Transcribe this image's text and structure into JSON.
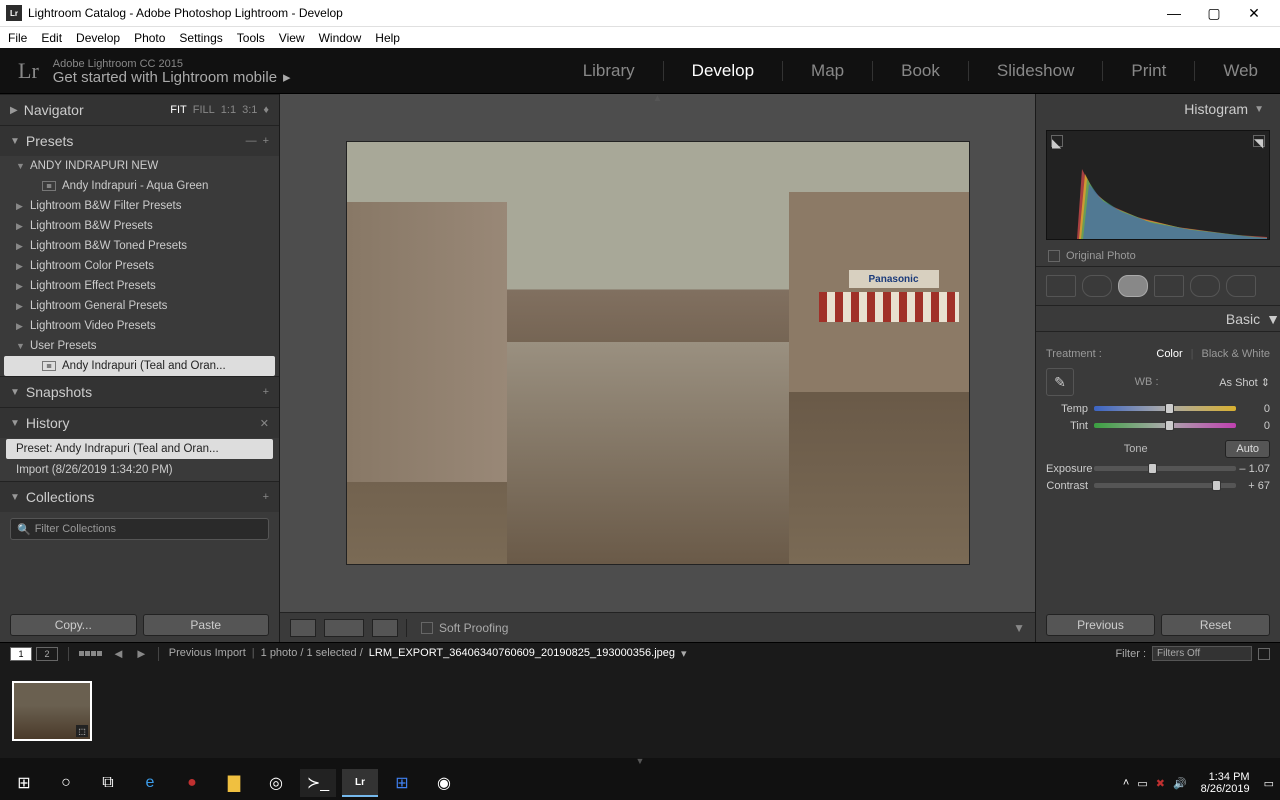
{
  "titlebar": {
    "title": "Lightroom Catalog - Adobe Photoshop Lightroom - Develop"
  },
  "menubar": [
    "File",
    "Edit",
    "Develop",
    "Photo",
    "Settings",
    "Tools",
    "View",
    "Window",
    "Help"
  ],
  "brand": {
    "line1": "Adobe Lightroom CC 2015",
    "line2": "Get started with Lightroom mobile"
  },
  "modules": [
    "Library",
    "Develop",
    "Map",
    "Book",
    "Slideshow",
    "Print",
    "Web"
  ],
  "active_module": "Develop",
  "navigator": {
    "title": "Navigator",
    "modes": [
      "FIT",
      "FILL",
      "1:1",
      "3:1"
    ],
    "active_mode": "FIT"
  },
  "presets": {
    "title": "Presets",
    "groups": [
      {
        "label": "ANDY INDRAPURI NEW",
        "expanded": true,
        "children": [
          "Andy Indrapuri - Aqua Green"
        ]
      },
      {
        "label": "Lightroom B&W Filter Presets",
        "expanded": false
      },
      {
        "label": "Lightroom B&W Presets",
        "expanded": false
      },
      {
        "label": "Lightroom B&W Toned Presets",
        "expanded": false
      },
      {
        "label": "Lightroom Color Presets",
        "expanded": false
      },
      {
        "label": "Lightroom Effect Presets",
        "expanded": false
      },
      {
        "label": "Lightroom General Presets",
        "expanded": false
      },
      {
        "label": "Lightroom Video Presets",
        "expanded": false
      },
      {
        "label": "User Presets",
        "expanded": true,
        "children": [
          "Andy Indrapuri (Teal and Oran..."
        ]
      }
    ],
    "selected_child": "Andy Indrapuri (Teal and Oran..."
  },
  "snapshots": {
    "title": "Snapshots"
  },
  "history": {
    "title": "History",
    "items": [
      "Preset: Andy Indrapuri (Teal and Oran...",
      "Import (8/26/2019 1:34:20 PM)"
    ],
    "selected": 0
  },
  "collections": {
    "title": "Collections",
    "filter_placeholder": "Filter Collections"
  },
  "left_buttons": {
    "copy": "Copy...",
    "paste": "Paste"
  },
  "toolbar": {
    "soft_proofing": "Soft Proofing"
  },
  "right": {
    "histogram": "Histogram",
    "original_photo": "Original Photo",
    "basic": {
      "title": "Basic",
      "treatment_label": "Treatment :",
      "color": "Color",
      "bw": "Black & White",
      "wb_label": "WB :",
      "wb_value": "As Shot",
      "sliders": {
        "temp": {
          "label": "Temp",
          "value": "0",
          "pos": 50
        },
        "tint": {
          "label": "Tint",
          "value": "0",
          "pos": 50
        },
        "exposure": {
          "label": "Exposure",
          "value": "– 1.07",
          "pos": 38
        },
        "contrast": {
          "label": "Contrast",
          "value": "+ 67",
          "pos": 83
        }
      },
      "tone_label": "Tone",
      "auto": "Auto"
    },
    "buttons": {
      "previous": "Previous",
      "reset": "Reset"
    }
  },
  "filmstrip": {
    "pages": [
      "1",
      "2"
    ],
    "breadcrumb": "Previous Import",
    "count": "1 photo / 1 selected /",
    "filename": "LRM_EXPORT_36406340760609_20190825_193000356.jpeg",
    "filter_label": "Filter :",
    "filter_value": "Filters Off"
  },
  "photo_sign": "Panasonic",
  "taskbar": {
    "time": "1:34 PM",
    "date": "8/26/2019"
  }
}
